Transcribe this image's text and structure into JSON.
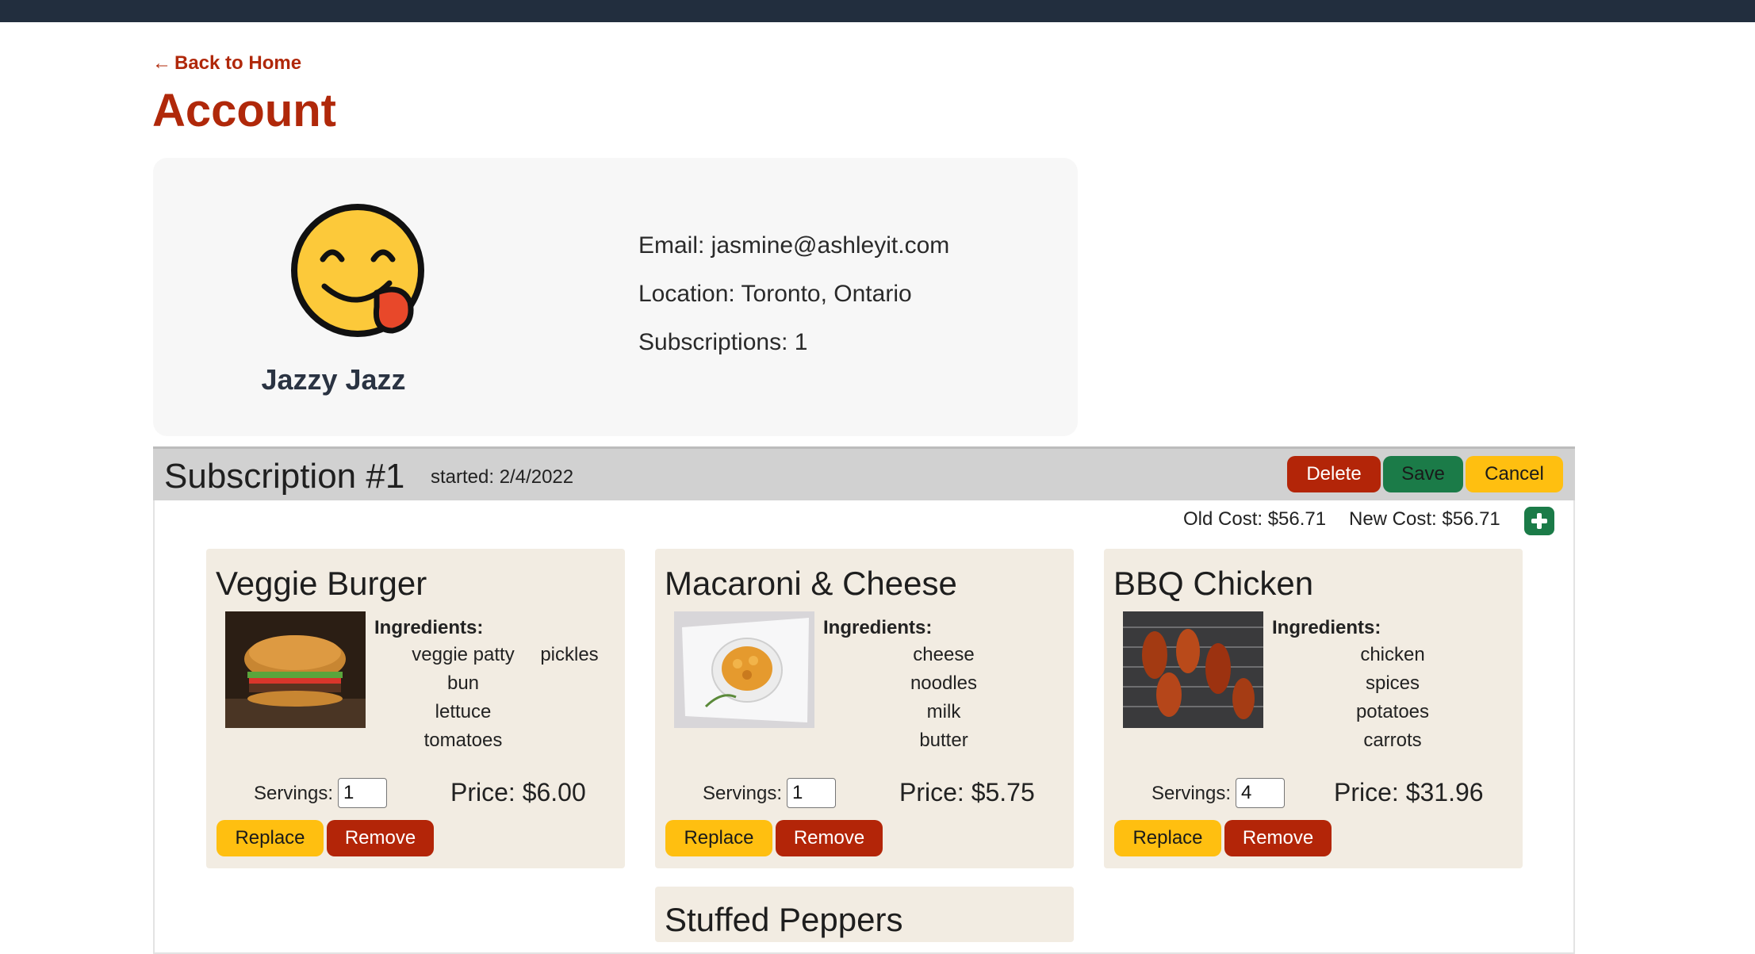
{
  "nav": {
    "back_arrow": "←",
    "back_label": "Back to Home"
  },
  "page": {
    "title": "Account"
  },
  "profile": {
    "avatar_icon": "savoring-food-emoji-icon",
    "name": "Jazzy Jazz",
    "email_line": "Email: jasmine@ashleyit.com",
    "location_line": "Location: Toronto, Ontario",
    "subscriptions_line": "Subscriptions: 1"
  },
  "subscription": {
    "title": "Subscription #1",
    "started": "started: 2/4/2022",
    "delete_label": "Delete",
    "save_label": "Save",
    "cancel_label": "Cancel",
    "old_cost": "Old Cost: $56.71",
    "new_cost": "New Cost: $56.71",
    "add_icon": "plus-icon"
  },
  "meals": [
    {
      "name": "Veggie Burger",
      "image": "burger-photo",
      "ingredients_label": "Ingredients:",
      "ingredients_col1": [
        "veggie patty",
        "bun",
        "lettuce",
        "tomatoes"
      ],
      "ingredients_col2": [
        "pickles"
      ],
      "servings_label": "Servings:",
      "servings": "1",
      "price": "Price: $6.00",
      "replace_label": "Replace",
      "remove_label": "Remove"
    },
    {
      "name": "Macaroni & Cheese",
      "image": "macaroni-photo",
      "ingredients_label": "Ingredients:",
      "ingredients_col1": [
        "cheese",
        "noodles",
        "milk",
        "butter"
      ],
      "servings_label": "Servings:",
      "servings": "1",
      "price": "Price: $5.75",
      "replace_label": "Replace",
      "remove_label": "Remove"
    },
    {
      "name": "BBQ Chicken",
      "image": "bbq-chicken-photo",
      "ingredients_label": "Ingredients:",
      "ingredients_col1": [
        "chicken",
        "spices",
        "potatoes",
        "carrots"
      ],
      "servings_label": "Servings:",
      "servings": "4",
      "price": "Price: $31.96",
      "replace_label": "Replace",
      "remove_label": "Remove"
    },
    {
      "name": "Stuffed Peppers"
    }
  ],
  "colors": {
    "topbar": "#222e3e",
    "accent_red": "#b0280a",
    "save_green": "#1b7b48",
    "cancel_yellow": "#ffbf10",
    "card_bg": "#f2ece2"
  }
}
